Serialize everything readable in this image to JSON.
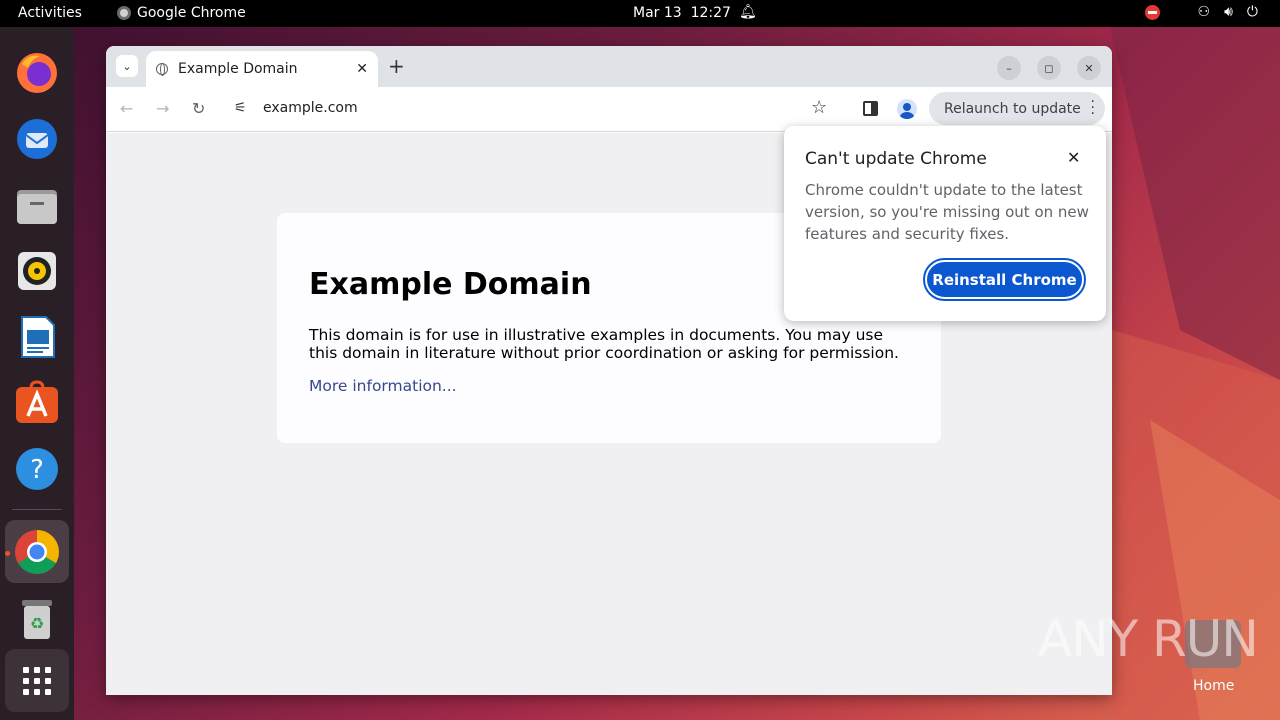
{
  "topbar": {
    "activities": "Activities",
    "app_name": "Google Chrome",
    "date": "Mar 13",
    "time": "12:27"
  },
  "dock": {
    "items": [
      "firefox-icon",
      "thunderbird-icon",
      "files-icon",
      "rhythmbox-icon",
      "writer-icon",
      "app-center-icon",
      "help-icon",
      "chrome-icon",
      "trash-icon",
      "show-apps-icon"
    ]
  },
  "browser": {
    "tab_title": "Example Domain",
    "url": "example.com",
    "relaunch_label": "Relaunch to update"
  },
  "page": {
    "heading": "Example Domain",
    "paragraph": "This domain is for use in illustrative examples in documents. You may use this domain in literature without prior coordination or asking for permission.",
    "link": "More information..."
  },
  "popup": {
    "title": "Can't update Chrome",
    "body": "Chrome couldn't update to the latest version, so you're missing out on new features and security fixes.",
    "button": "Reinstall Chrome"
  },
  "desktop": {
    "watermark": "ANY RUN",
    "home_label": "Home"
  },
  "colors": {
    "accent": "#0b57d0",
    "ubuntu_orange": "#e95420",
    "link": "#38488f"
  }
}
